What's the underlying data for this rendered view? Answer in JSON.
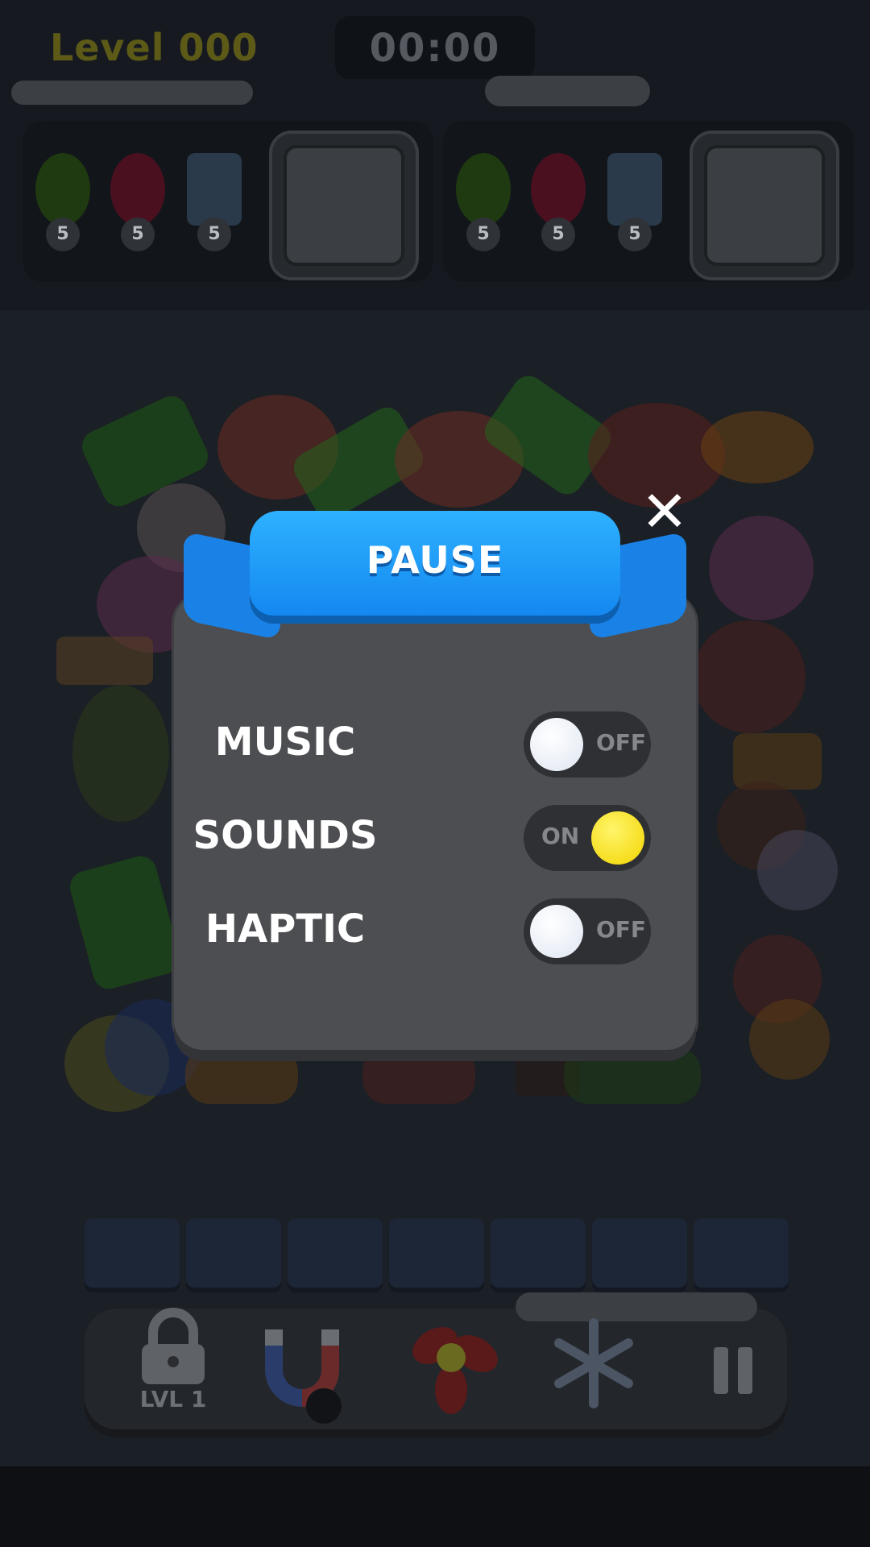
{
  "header": {
    "level_label": "Level 000",
    "timer": "00:00"
  },
  "goals": [
    {
      "items": [
        {
          "icon": "leaf-icon",
          "count": "5",
          "color": "#1f3a10"
        },
        {
          "icon": "beet-icon",
          "count": "5",
          "color": "#4a1020"
        },
        {
          "icon": "cake-slice-icon",
          "count": "5",
          "color": "#2a3a4a"
        }
      ]
    },
    {
      "items": [
        {
          "icon": "leaf-icon",
          "count": "5",
          "color": "#1f3a10"
        },
        {
          "icon": "beet-icon",
          "count": "5",
          "color": "#4a1020"
        },
        {
          "icon": "cake-slice-icon",
          "count": "5",
          "color": "#2a3a4a"
        }
      ]
    }
  ],
  "boosters": {
    "lock_label": "LVL 1"
  },
  "dialog": {
    "title": "PAUSE",
    "close_icon": "close-icon",
    "settings": [
      {
        "label": "MUSIC",
        "state": "OFF"
      },
      {
        "label": "SOUNDS",
        "state": "ON"
      },
      {
        "label": "HAPTIC",
        "state": "OFF"
      }
    ]
  },
  "colors": {
    "ribbon": "#1f9af5",
    "toggle_on": "#f7e21a",
    "toggle_off": "#eef2f8"
  }
}
